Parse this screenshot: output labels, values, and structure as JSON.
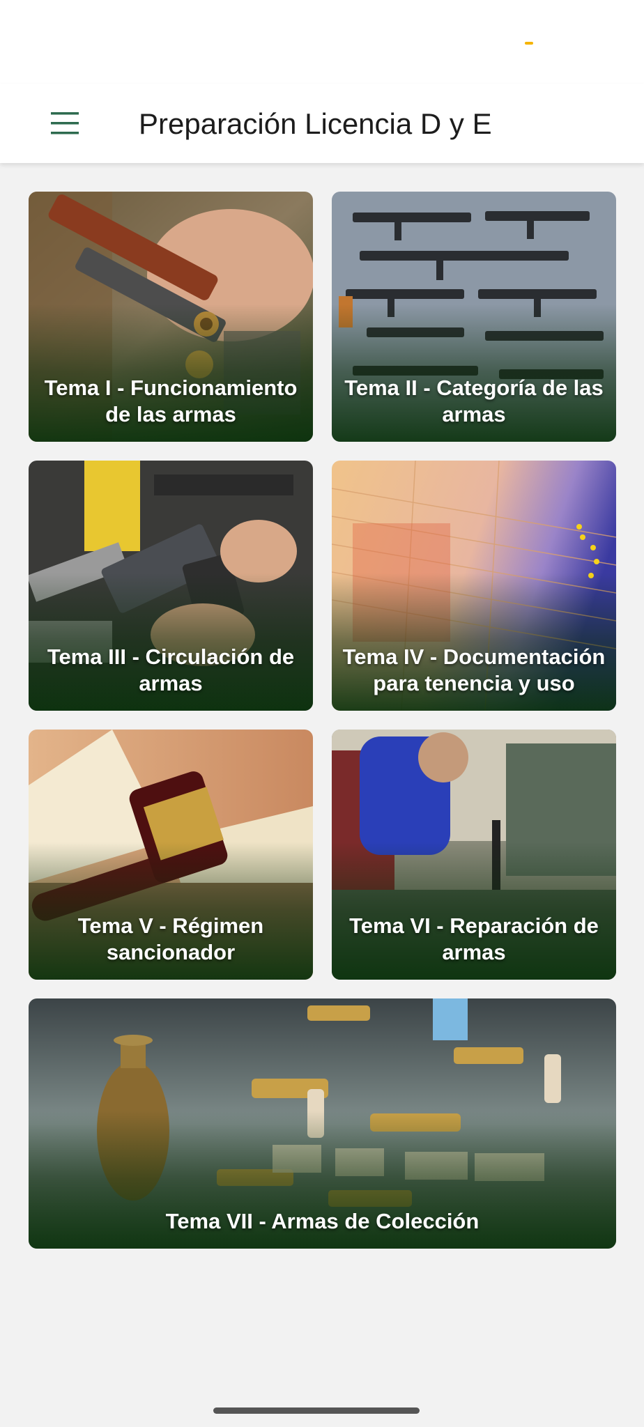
{
  "app_bar": {
    "title": "Preparación Licencia D y E",
    "menu_icon": "hamburger-menu-icon",
    "accent_color": "#2e6b4f"
  },
  "topics": [
    {
      "label": "Tema I - Funcionamiento de las armas"
    },
    {
      "label": "Tema II - Categoría de las armas"
    },
    {
      "label": "Tema III - Circulación de armas"
    },
    {
      "label": "Tema IV - Documentación para tenencia y uso"
    },
    {
      "label": "Tema V - Régimen sancionador"
    },
    {
      "label": "Tema VI - Reparación de armas"
    },
    {
      "label": "Tema VII - Armas de Colección"
    }
  ],
  "colors": {
    "card_overlay": "#0c3a10",
    "background": "#f2f2f2"
  }
}
